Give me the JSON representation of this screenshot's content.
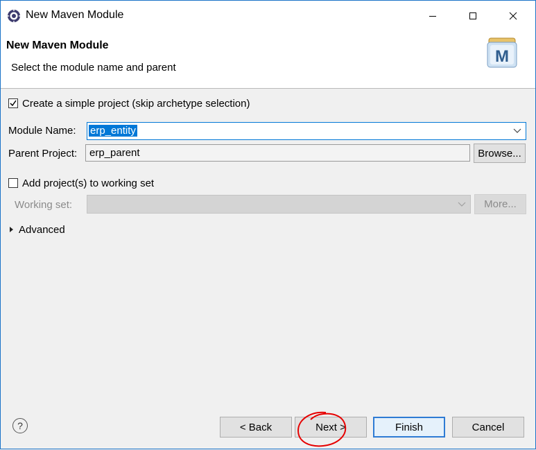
{
  "window": {
    "title": "New Maven Module"
  },
  "header": {
    "title": "New Maven Module",
    "subtitle": "Select the module name and parent"
  },
  "simple_project": {
    "label": "Create a simple project (skip archetype selection)",
    "checked": true
  },
  "module_name": {
    "label": "Module Name:",
    "value": "erp_entity"
  },
  "parent_project": {
    "label": "Parent Project:",
    "value": "erp_parent",
    "browse_label": "Browse..."
  },
  "working_set": {
    "checkbox_label": "Add project(s) to working set",
    "checked": false,
    "label": "Working set:",
    "value": "",
    "more_label": "More..."
  },
  "advanced": {
    "label": "Advanced"
  },
  "footer": {
    "back": "< Back",
    "next": "Next >",
    "finish": "Finish",
    "cancel": "Cancel",
    "help": "?"
  },
  "colors": {
    "accent": "#0078d7",
    "annotation": "#e60000"
  }
}
